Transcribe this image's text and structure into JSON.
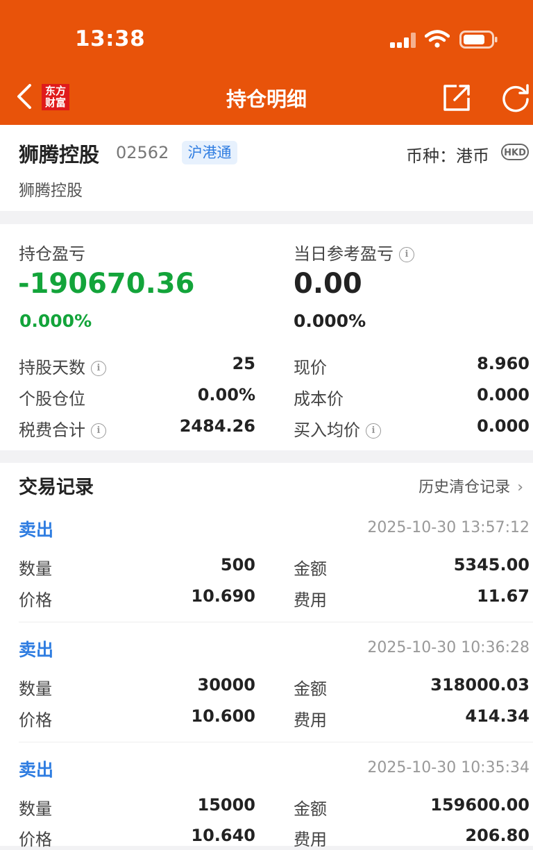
{
  "status_bar": {
    "time": "13:38"
  },
  "nav": {
    "title": "持仓明细",
    "logo_line1": "东方",
    "logo_line2": "财富"
  },
  "stock": {
    "name": "狮腾控股",
    "code": "02562",
    "tag": "沪港通",
    "currency_label": "币种：港币",
    "currency_badge": "HKD",
    "subname": "狮腾控股"
  },
  "pnl": {
    "position_label": "持仓盈亏",
    "position_value": "-190670.36",
    "position_pct": "0.000%",
    "daily_label": "当日参考盈亏",
    "daily_value": "0.00",
    "daily_pct": "0.000%",
    "stats_left": [
      {
        "label": "持股天数",
        "value": "25",
        "info": true
      },
      {
        "label": "个股仓位",
        "value": "0.00%",
        "info": false
      },
      {
        "label": "税费合计",
        "value": "2484.26",
        "info": true
      }
    ],
    "stats_right": [
      {
        "label": "现价",
        "value": "8.960",
        "info": false
      },
      {
        "label": "成本价",
        "value": "0.000",
        "info": false
      },
      {
        "label": "买入均价",
        "value": "0.000",
        "info": true
      }
    ]
  },
  "trades": {
    "title": "交易记录",
    "history_link": "历史清仓记录",
    "qty_label": "数量",
    "price_label": "价格",
    "amount_label": "金额",
    "fee_label": "费用",
    "records": [
      {
        "action": "卖出",
        "time": "2025-10-30 13:57:12",
        "qty": "500",
        "price": "10.690",
        "amount": "5345.00",
        "fee": "11.67"
      },
      {
        "action": "卖出",
        "time": "2025-10-30 10:36:28",
        "qty": "30000",
        "price": "10.600",
        "amount": "318000.03",
        "fee": "414.34"
      },
      {
        "action": "卖出",
        "time": "2025-10-30 10:35:34",
        "qty": "15000",
        "price": "10.640",
        "amount": "159600.00",
        "fee": "206.80"
      }
    ]
  },
  "colors": {
    "brand": "#e8530a",
    "loss_green": "#13a43a",
    "action_blue": "#2f7de1"
  },
  "icons": [
    "back-icon",
    "share-icon",
    "refresh-icon",
    "info-icon",
    "chevron-right-icon",
    "signal-icon",
    "wifi-icon",
    "battery-icon"
  ]
}
